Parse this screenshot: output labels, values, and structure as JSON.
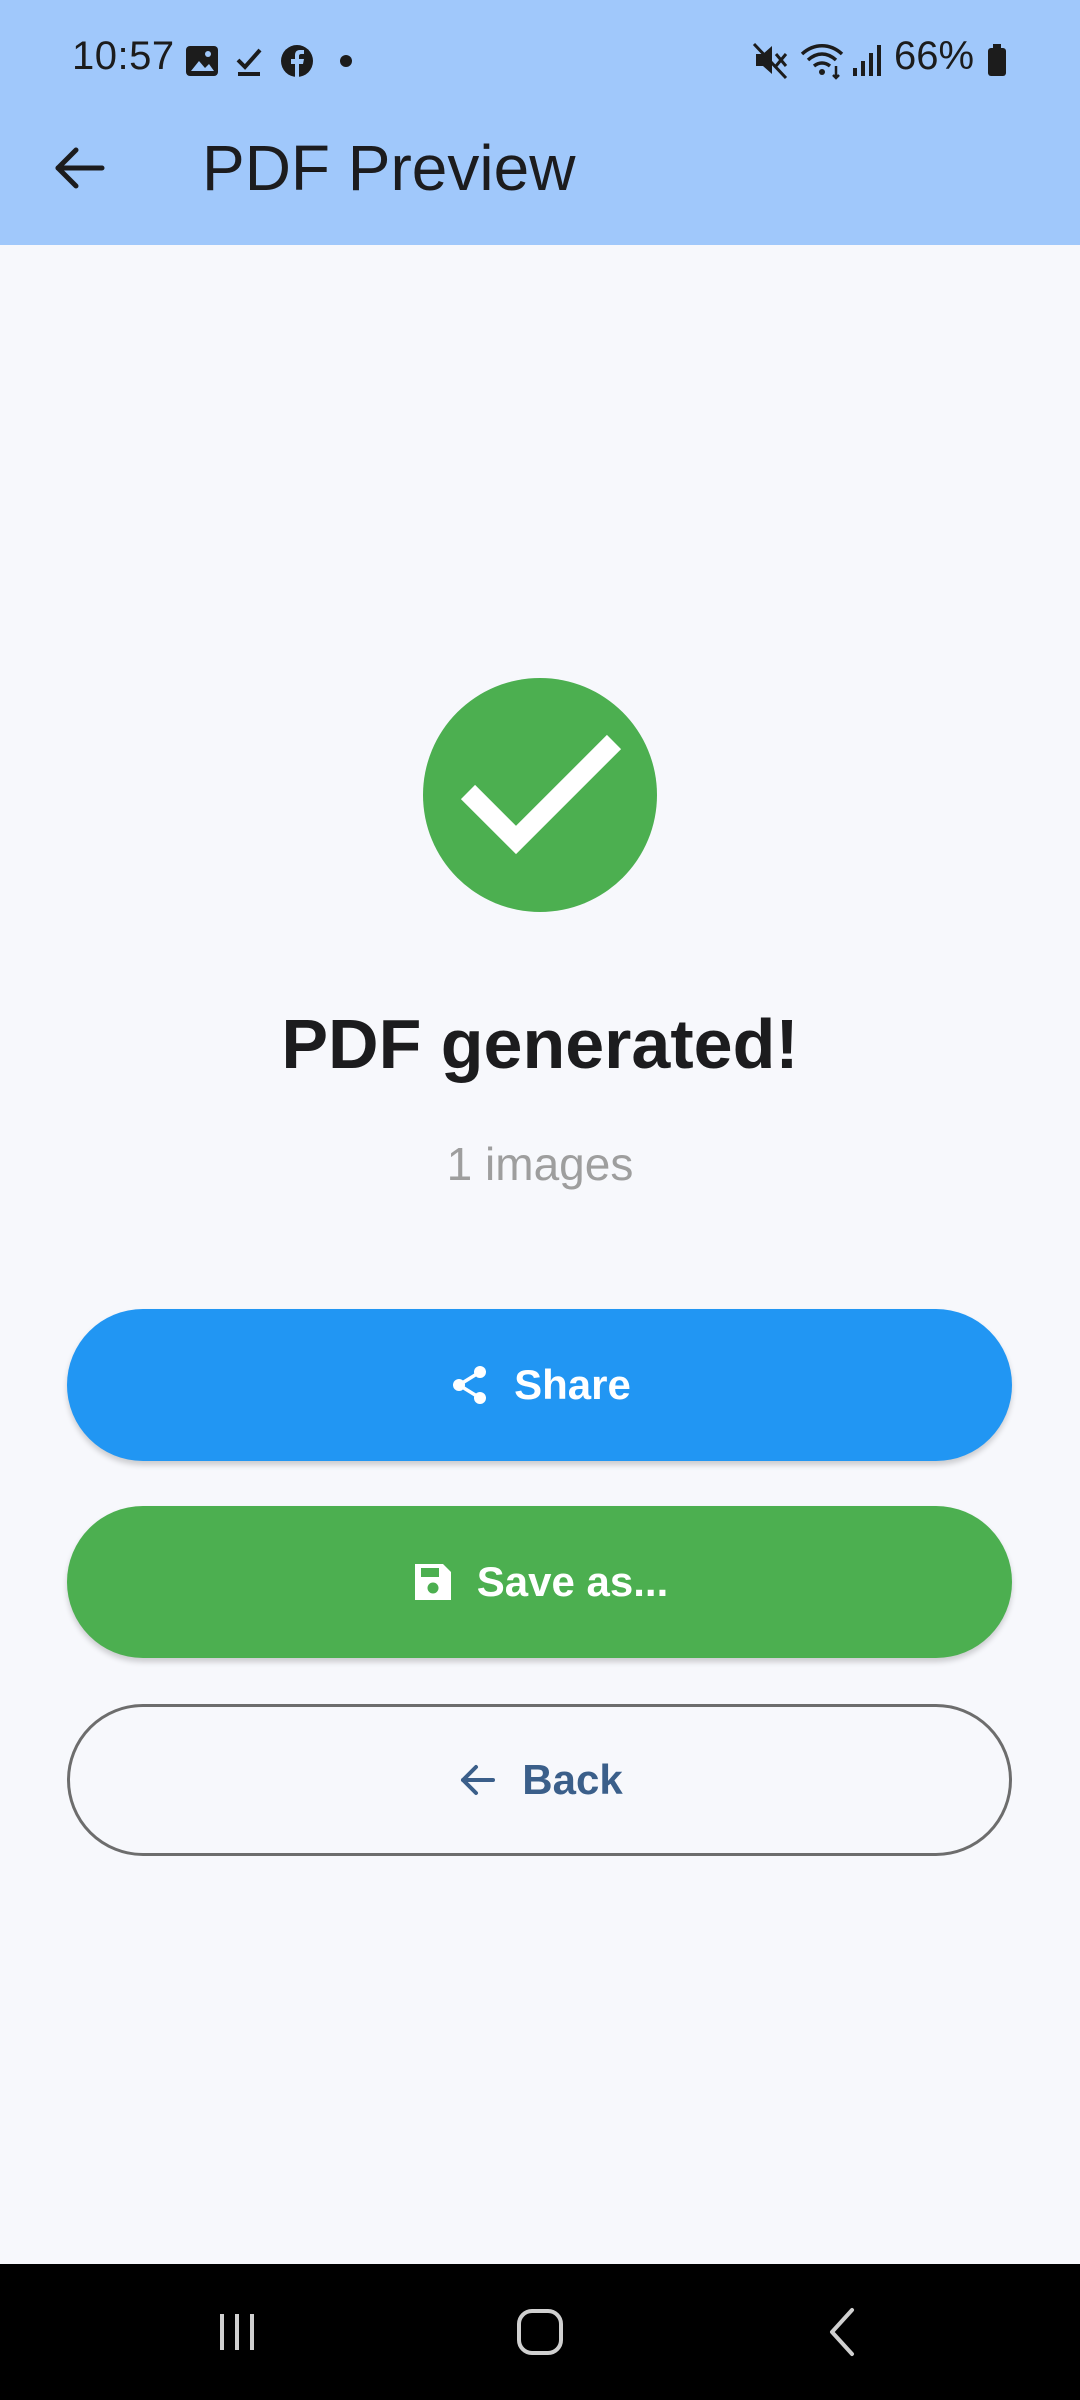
{
  "status_bar": {
    "time": "10:57",
    "battery": "66%",
    "left_icons": [
      "gallery-icon",
      "check-icon",
      "facebook-icon",
      "dot-icon"
    ],
    "right_icons": [
      "mute-icon",
      "wifi-icon",
      "signal-icon",
      "battery-icon"
    ]
  },
  "app_bar": {
    "title": "PDF Preview",
    "back_icon": "arrow-back-icon",
    "background": "#a0c8fb"
  },
  "result": {
    "headline": "PDF generated!",
    "subtitle": "1 images",
    "success_color": "#4caf50"
  },
  "actions": {
    "share_label": "Share",
    "save_label": "Save as...",
    "back_label": "Back",
    "share_color": "#2196f3",
    "save_color": "#4caf50"
  },
  "nav_bar": {
    "icons": [
      "recent-apps-icon",
      "home-icon",
      "back-icon"
    ]
  }
}
